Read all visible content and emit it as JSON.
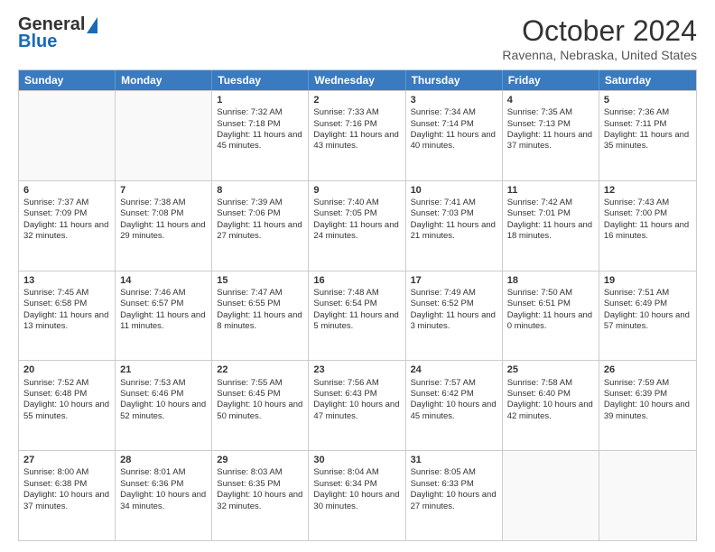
{
  "logo": {
    "line1": "General",
    "line2": "Blue"
  },
  "header": {
    "month": "October 2024",
    "location": "Ravenna, Nebraska, United States"
  },
  "days": [
    "Sunday",
    "Monday",
    "Tuesday",
    "Wednesday",
    "Thursday",
    "Friday",
    "Saturday"
  ],
  "weeks": [
    [
      {
        "day": "",
        "empty": true
      },
      {
        "day": "",
        "empty": true
      },
      {
        "day": "1",
        "sunrise": "7:32 AM",
        "sunset": "7:18 PM",
        "daylight": "11 hours and 45 minutes."
      },
      {
        "day": "2",
        "sunrise": "7:33 AM",
        "sunset": "7:16 PM",
        "daylight": "11 hours and 43 minutes."
      },
      {
        "day": "3",
        "sunrise": "7:34 AM",
        "sunset": "7:14 PM",
        "daylight": "11 hours and 40 minutes."
      },
      {
        "day": "4",
        "sunrise": "7:35 AM",
        "sunset": "7:13 PM",
        "daylight": "11 hours and 37 minutes."
      },
      {
        "day": "5",
        "sunrise": "7:36 AM",
        "sunset": "7:11 PM",
        "daylight": "11 hours and 35 minutes."
      }
    ],
    [
      {
        "day": "6",
        "sunrise": "7:37 AM",
        "sunset": "7:09 PM",
        "daylight": "11 hours and 32 minutes."
      },
      {
        "day": "7",
        "sunrise": "7:38 AM",
        "sunset": "7:08 PM",
        "daylight": "11 hours and 29 minutes."
      },
      {
        "day": "8",
        "sunrise": "7:39 AM",
        "sunset": "7:06 PM",
        "daylight": "11 hours and 27 minutes."
      },
      {
        "day": "9",
        "sunrise": "7:40 AM",
        "sunset": "7:05 PM",
        "daylight": "11 hours and 24 minutes."
      },
      {
        "day": "10",
        "sunrise": "7:41 AM",
        "sunset": "7:03 PM",
        "daylight": "11 hours and 21 minutes."
      },
      {
        "day": "11",
        "sunrise": "7:42 AM",
        "sunset": "7:01 PM",
        "daylight": "11 hours and 18 minutes."
      },
      {
        "day": "12",
        "sunrise": "7:43 AM",
        "sunset": "7:00 PM",
        "daylight": "11 hours and 16 minutes."
      }
    ],
    [
      {
        "day": "13",
        "sunrise": "7:45 AM",
        "sunset": "6:58 PM",
        "daylight": "11 hours and 13 minutes."
      },
      {
        "day": "14",
        "sunrise": "7:46 AM",
        "sunset": "6:57 PM",
        "daylight": "11 hours and 11 minutes."
      },
      {
        "day": "15",
        "sunrise": "7:47 AM",
        "sunset": "6:55 PM",
        "daylight": "11 hours and 8 minutes."
      },
      {
        "day": "16",
        "sunrise": "7:48 AM",
        "sunset": "6:54 PM",
        "daylight": "11 hours and 5 minutes."
      },
      {
        "day": "17",
        "sunrise": "7:49 AM",
        "sunset": "6:52 PM",
        "daylight": "11 hours and 3 minutes."
      },
      {
        "day": "18",
        "sunrise": "7:50 AM",
        "sunset": "6:51 PM",
        "daylight": "11 hours and 0 minutes."
      },
      {
        "day": "19",
        "sunrise": "7:51 AM",
        "sunset": "6:49 PM",
        "daylight": "10 hours and 57 minutes."
      }
    ],
    [
      {
        "day": "20",
        "sunrise": "7:52 AM",
        "sunset": "6:48 PM",
        "daylight": "10 hours and 55 minutes."
      },
      {
        "day": "21",
        "sunrise": "7:53 AM",
        "sunset": "6:46 PM",
        "daylight": "10 hours and 52 minutes."
      },
      {
        "day": "22",
        "sunrise": "7:55 AM",
        "sunset": "6:45 PM",
        "daylight": "10 hours and 50 minutes."
      },
      {
        "day": "23",
        "sunrise": "7:56 AM",
        "sunset": "6:43 PM",
        "daylight": "10 hours and 47 minutes."
      },
      {
        "day": "24",
        "sunrise": "7:57 AM",
        "sunset": "6:42 PM",
        "daylight": "10 hours and 45 minutes."
      },
      {
        "day": "25",
        "sunrise": "7:58 AM",
        "sunset": "6:40 PM",
        "daylight": "10 hours and 42 minutes."
      },
      {
        "day": "26",
        "sunrise": "7:59 AM",
        "sunset": "6:39 PM",
        "daylight": "10 hours and 39 minutes."
      }
    ],
    [
      {
        "day": "27",
        "sunrise": "8:00 AM",
        "sunset": "6:38 PM",
        "daylight": "10 hours and 37 minutes."
      },
      {
        "day": "28",
        "sunrise": "8:01 AM",
        "sunset": "6:36 PM",
        "daylight": "10 hours and 34 minutes."
      },
      {
        "day": "29",
        "sunrise": "8:03 AM",
        "sunset": "6:35 PM",
        "daylight": "10 hours and 32 minutes."
      },
      {
        "day": "30",
        "sunrise": "8:04 AM",
        "sunset": "6:34 PM",
        "daylight": "10 hours and 30 minutes."
      },
      {
        "day": "31",
        "sunrise": "8:05 AM",
        "sunset": "6:33 PM",
        "daylight": "10 hours and 27 minutes."
      },
      {
        "day": "",
        "empty": true
      },
      {
        "day": "",
        "empty": true
      }
    ]
  ]
}
